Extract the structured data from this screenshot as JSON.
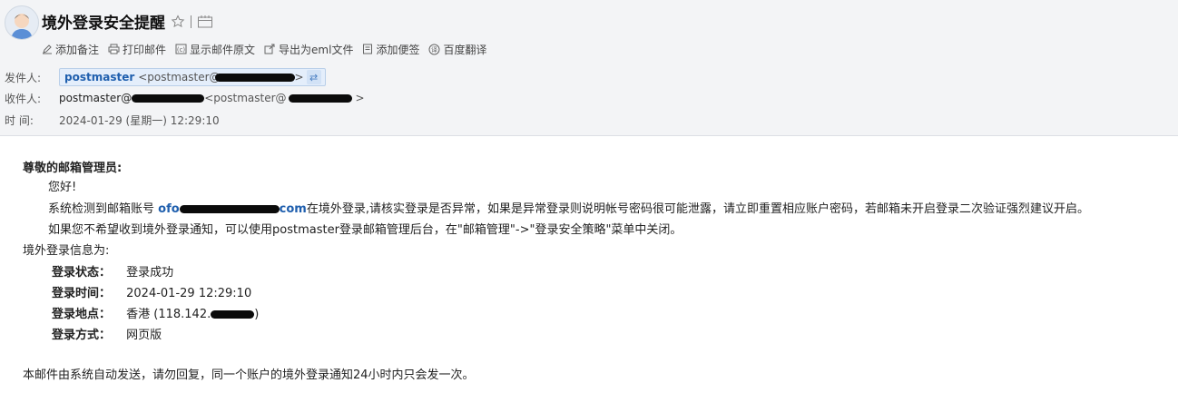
{
  "header": {
    "subject": "境外登录安全提醒",
    "toolbar": [
      {
        "icon": "pen-icon",
        "label": "添加备注"
      },
      {
        "icon": "printer-icon",
        "label": "打印邮件"
      },
      {
        "icon": "source-icon",
        "label": "显示邮件原文"
      },
      {
        "icon": "export-icon",
        "label": "导出为eml文件"
      },
      {
        "icon": "note-icon",
        "label": "添加便签"
      },
      {
        "icon": "translate-icon",
        "label": "百度翻译"
      }
    ]
  },
  "meta": {
    "from_label": "发件人:",
    "from_name": "postmaster",
    "from_addr_prefix": "<postmaster@",
    "from_addr_suffix": ">",
    "to_label": "收件人:",
    "to_name_prefix": "postmaster@",
    "to_addr_prefix": "<postmaster@",
    "to_addr_suffix": ">",
    "time_label": "时 间:",
    "time_value": "2024-01-29 (星期一) 12:29:10"
  },
  "body": {
    "greeting": "尊敬的邮箱管理员:",
    "hello": "您好!",
    "para1_before": "系统检测到邮箱账号 ",
    "para1_link_prefix": "ofo",
    "para1_link_suffix": "com",
    "para1_after": "在境外登录,请核实登录是否异常，如果是异常登录则说明帐号密码很可能泄露，请立即重置相应账户密码，若邮箱未开启登录二次验证强烈建议开启。",
    "para2": "如果您不希望收到境外登录通知，可以使用postmaster登录邮箱管理后台，在\"邮箱管理\"->\"登录安全策略\"菜单中关闭。",
    "info_title": "境外登录信息为:",
    "info": [
      {
        "key": "登录状态：",
        "value": "登录成功"
      },
      {
        "key": "登录时间：",
        "value": "2024-01-29 12:29:10"
      },
      {
        "key": "登录地点：",
        "value": "香港 (118.142.",
        "value_suffix": ")"
      },
      {
        "key": "登录方式：",
        "value": "网页版"
      }
    ],
    "footer": "本邮件由系统自动发送，请勿回复，同一个账户的境外登录通知24小时内只会发一次。"
  },
  "colors": {
    "link": "#1f5fae",
    "header_bg": "#f3f4f6",
    "mask": "#0b0b0b"
  }
}
